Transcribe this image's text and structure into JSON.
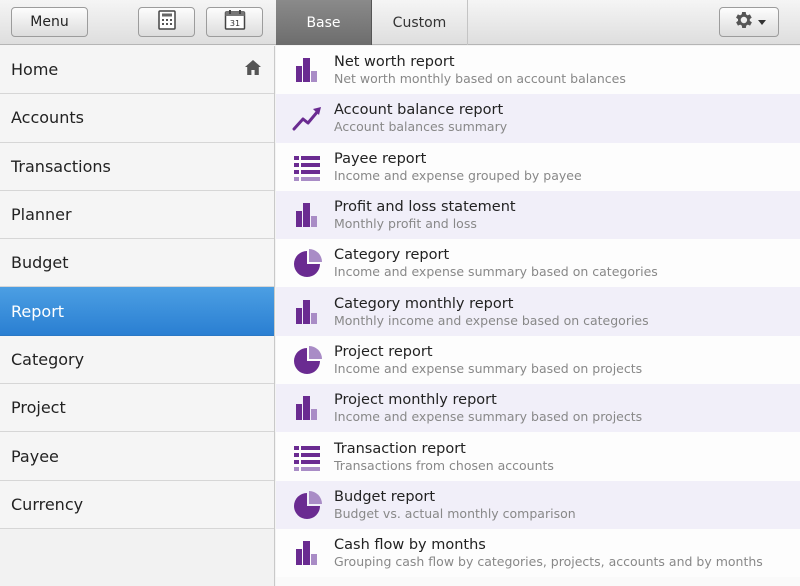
{
  "toolbar": {
    "menu_label": "Menu",
    "calculator_icon": "calculator-icon",
    "calendar_icon": "calendar-icon",
    "calendar_day": "31",
    "settings_icon": "gear-icon"
  },
  "tabs": [
    {
      "label": "Base",
      "active": true
    },
    {
      "label": "Custom",
      "active": false
    }
  ],
  "sidebar": {
    "items": [
      {
        "label": "Home",
        "icon": "home-icon"
      },
      {
        "label": "Accounts"
      },
      {
        "label": "Transactions"
      },
      {
        "label": "Planner"
      },
      {
        "label": "Budget"
      },
      {
        "label": "Report",
        "selected": true
      },
      {
        "label": "Category"
      },
      {
        "label": "Project"
      },
      {
        "label": "Payee"
      },
      {
        "label": "Currency"
      }
    ]
  },
  "reports": [
    {
      "title": "Net worth report",
      "desc": "Net worth monthly based on account balances",
      "icon": "bar-chart-icon"
    },
    {
      "title": "Account balance report",
      "desc": "Account balances summary",
      "icon": "trend-line-icon"
    },
    {
      "title": "Payee report",
      "desc": "Income and expense grouped by payee",
      "icon": "list-icon"
    },
    {
      "title": "Profit and loss statement",
      "desc": "Monthly profit and loss",
      "icon": "bar-chart-icon"
    },
    {
      "title": "Category report",
      "desc": "Income and expense summary based on categories",
      "icon": "pie-chart-icon"
    },
    {
      "title": "Category monthly report",
      "desc": "Monthly income and expense based on categories",
      "icon": "bar-chart-icon"
    },
    {
      "title": "Project report",
      "desc": "Income and expense summary based on projects",
      "icon": "pie-chart-icon"
    },
    {
      "title": "Project monthly report",
      "desc": "Income and expense summary based on projects",
      "icon": "bar-chart-icon"
    },
    {
      "title": "Transaction report",
      "desc": "Transactions from chosen accounts",
      "icon": "list-icon"
    },
    {
      "title": "Budget report",
      "desc": "Budget vs. actual monthly comparison",
      "icon": "pie-chart-icon"
    },
    {
      "title": "Cash flow by months",
      "desc": "Grouping cash flow by categories, projects, accounts and by months",
      "icon": "bar-chart-icon"
    }
  ],
  "colors": {
    "accent": "#2a7fd2",
    "icon_purple": "#6a2b91",
    "icon_purple_light": "#a98cc6"
  }
}
